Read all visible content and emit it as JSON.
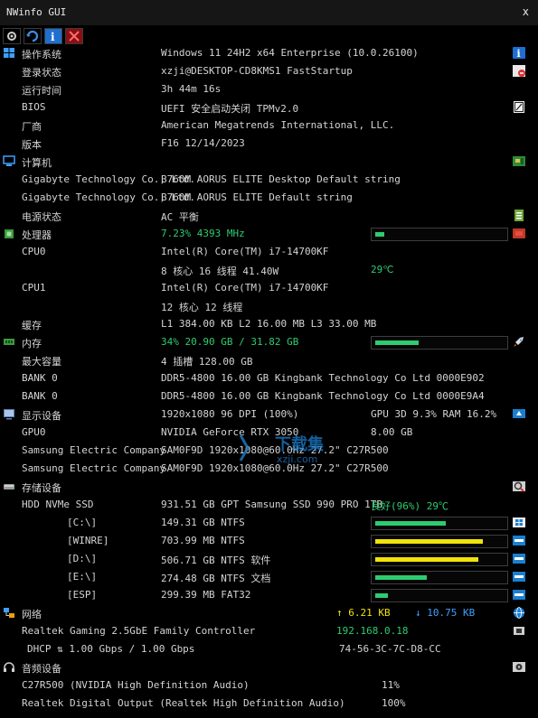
{
  "window": {
    "title": "NWinfo GUI",
    "close": "x"
  },
  "toolbar": {
    "icons": [
      "settings-icon",
      "refresh-icon",
      "info-icon",
      "close-icon"
    ]
  },
  "os": {
    "label": "操作系统",
    "value": "Windows 11 24H2 x64 Enterprise (10.0.26100)",
    "login_label": "登录状态",
    "login_value": "xzji@DESKTOP-CD8KMS1 FastStartup",
    "uptime_label": "运行时间",
    "uptime_value": "3h 44m 16s",
    "bios_label": "BIOS",
    "bios_value": "UEFI 安全启动关闭 TPMv2.0",
    "vendor_label": "厂商",
    "vendor_value": "American Megatrends International, LLC.",
    "version_label": "版本",
    "version_value": "F16 12/14/2023"
  },
  "computer": {
    "label": "计算机",
    "line1_name": "Gigabyte Technology Co., Ltd.",
    "line1_value": "B760M AORUS ELITE Desktop Default string",
    "line2_name": "Gigabyte Technology Co., Ltd.",
    "line2_value": "B760M AORUS ELITE Default string",
    "power_label": "电源状态",
    "power_value": "AC  平衡"
  },
  "cpu": {
    "label": "处理器",
    "usage": "7.23% 4393 MHz",
    "usage_fraction": 0.07,
    "cpu0_label": "CPU0",
    "cpu0_name": "Intel(R) Core(TM) i7-14700KF",
    "cpu0_detail": "8 核心 16 线程 41.40W",
    "cpu0_temp": "29℃",
    "cpu1_label": "CPU1",
    "cpu1_name": "Intel(R) Core(TM) i7-14700KF",
    "cpu1_detail": "12 核心 12 线程",
    "cache_label": "缓存",
    "cache_value": "L1 384.00 KB L2 16.00 MB L3 33.00 MB"
  },
  "memory": {
    "label": "内存",
    "usage": "34% 20.90 GB / 31.82 GB",
    "usage_fraction": 0.34,
    "max_label": "最大容量",
    "max_value": "4 插槽 128.00 GB",
    "bank0a_label": "BANK 0",
    "bank0a_value": "DDR5-4800 16.00 GB Kingbank Technology Co Ltd 0000E902",
    "bank0b_label": "BANK 0",
    "bank0b_value": "DDR5-4800 16.00 GB Kingbank Technology Co Ltd 0000E9A4"
  },
  "display": {
    "label": "显示设备",
    "value": "1920x1080 96 DPI (100%)",
    "gpu_stats": "GPU 3D 9.3% RAM 16.2%",
    "gpu0_label": "GPU0",
    "gpu0_name": "NVIDIA GeForce RTX 3050",
    "gpu0_mem": "8.00 GB",
    "mon1_label": "Samsung Electric Company",
    "mon1_value": "SAM0F9D 1920x1080@60.0Hz 27.2\" C27R500",
    "mon2_label": "Samsung Electric Company",
    "mon2_value": "SAM0F9D 1920x1080@60.0Hz 27.2\" C27R500"
  },
  "storage": {
    "label": "存储设备",
    "disk_label": "HDD NVMe SSD",
    "disk_value": "931.51 GB GPT Samsung SSD 990 PRO 1TB",
    "disk_health": "良好(96%) 29℃",
    "partitions": [
      {
        "name": "[C:\\]",
        "info": "149.31 GB NTFS",
        "usage_fraction": 0.55,
        "color": "#2ecc71"
      },
      {
        "name": "[WINRE]",
        "info": "703.99 MB NTFS",
        "usage_fraction": 0.84,
        "color": "#f1e20c"
      },
      {
        "name": "[D:\\]",
        "info": "506.71 GB NTFS 软件",
        "usage_fraction": 0.8,
        "color": "#f1e20c"
      },
      {
        "name": "[E:\\]",
        "info": "274.48 GB NTFS 文档",
        "usage_fraction": 0.4,
        "color": "#2ecc71"
      },
      {
        "name": "[ESP]",
        "info": "299.39 MB FAT32",
        "usage_fraction": 0.1,
        "color": "#2ecc71"
      }
    ]
  },
  "network": {
    "label": "网络",
    "upload": "↑ 6.21 KB",
    "download": "↓ 10.75 KB",
    "adapter_label": "Realtek Gaming 2.5GbE Family Controller",
    "adapter_ip": "192.168.0.18",
    "dhcp_label": "DHCP ⇅ 1.00 Gbps / 1.00 Gbps",
    "mac": "74-56-3C-7C-D8-CC"
  },
  "audio": {
    "label": "音频设备",
    "dev1_label": "C27R500 (NVIDIA High Definition Audio)",
    "dev1_value": "11%",
    "dev2_label": "Realtek Digital Output (Realtek High Definition Audio)",
    "dev2_value": "100%"
  },
  "watermark": {
    "text_cn": "下载集",
    "text_url": "xzji.com"
  },
  "colors": {
    "green": "#2ecc71",
    "yellow": "#f1e20c",
    "blue": "#3fa0ff",
    "text": "#d4d4d4"
  }
}
